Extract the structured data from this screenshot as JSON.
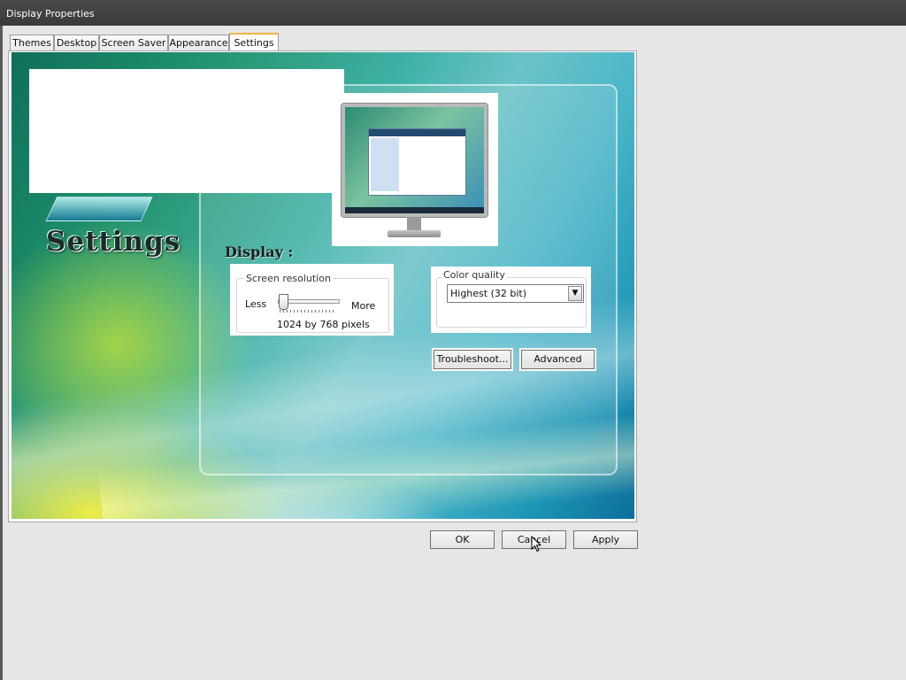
{
  "window": {
    "title": "Display Properties"
  },
  "tabs": [
    {
      "label": "Themes"
    },
    {
      "label": "Desktop"
    },
    {
      "label": "Screen Saver"
    },
    {
      "label": "Appearance"
    },
    {
      "label": "Settings"
    }
  ],
  "active_tab": "Settings",
  "banner": {
    "heading": "Settings"
  },
  "display": {
    "label": "Display :",
    "resolution": {
      "title": "Screen resolution",
      "less": "Less",
      "more": "More",
      "value": "1024 by 768 pixels",
      "slider_position": 0.05
    },
    "color_quality": {
      "title": "Color quality",
      "selected": "Highest (32 bit)"
    },
    "troubleshoot_label": "Troubleshoot...",
    "advanced_label": "Advanced"
  },
  "footer": {
    "ok_label": "OK",
    "cancel_label": "Cancel",
    "apply_label": "Apply"
  },
  "icons": [
    "monitor-preview-icon",
    "dropdown-arrow-icon",
    "mouse-cursor-icon"
  ]
}
